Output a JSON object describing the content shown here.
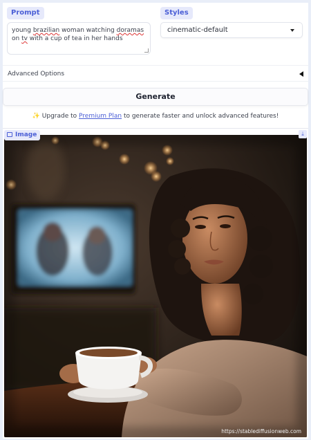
{
  "prompt": {
    "label": "Prompt",
    "value_parts": [
      "young ",
      "brazilian",
      " woman watching ",
      "doramas",
      " on ",
      "tv",
      " with a cup of tea in her hands"
    ]
  },
  "styles": {
    "label": "Styles",
    "selected": "cinematic-default"
  },
  "advanced": {
    "label": "Advanced Options"
  },
  "generate": {
    "label": "Generate"
  },
  "upgrade": {
    "icon": "sparkle-icon",
    "prefix": "Upgrade to ",
    "link": "Premium Plan",
    "suffix": " to generate faster and unlock advanced features!"
  },
  "image": {
    "label": "Image",
    "watermark": "https://stablediffusionweb.com"
  },
  "colors": {
    "accent": "#4b5fd6",
    "label_bg": "#e6e9fb",
    "page_bg": "#e9eef8"
  }
}
